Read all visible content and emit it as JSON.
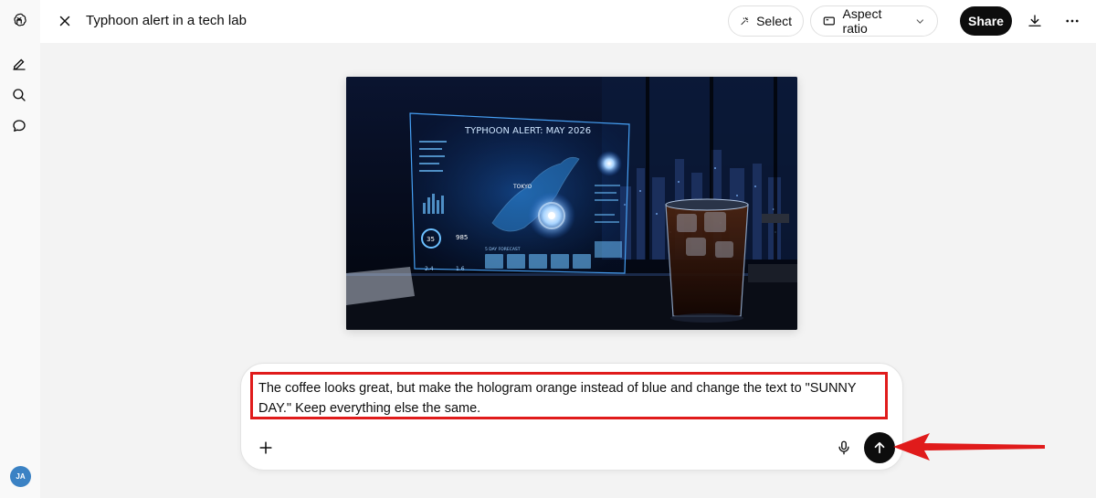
{
  "header": {
    "title": "Typhoon alert in a tech lab",
    "select_label": "Select",
    "aspect_label": "Aspect ratio",
    "share_label": "Share"
  },
  "sidebar": {
    "avatar_initials": "JA"
  },
  "image": {
    "hologram_title": "TYPHOON ALERT: MAY 2026",
    "city_label": "TOKYO",
    "gauge_value": "35",
    "pressure_value": "985",
    "wind_value": "2.4",
    "forecast_label": "5 DAY FORECAST",
    "temp_value": "1.6"
  },
  "composer": {
    "prompt_text": "The coffee looks great, but make the hologram orange instead of blue and change the text to \"SUNNY DAY.\" Keep everything else the same."
  },
  "colors": {
    "highlight_border": "#e01b1b",
    "arrow": "#e01b1b",
    "send_bg": "#0d0d0d",
    "hologram": "#4aa8ff"
  }
}
